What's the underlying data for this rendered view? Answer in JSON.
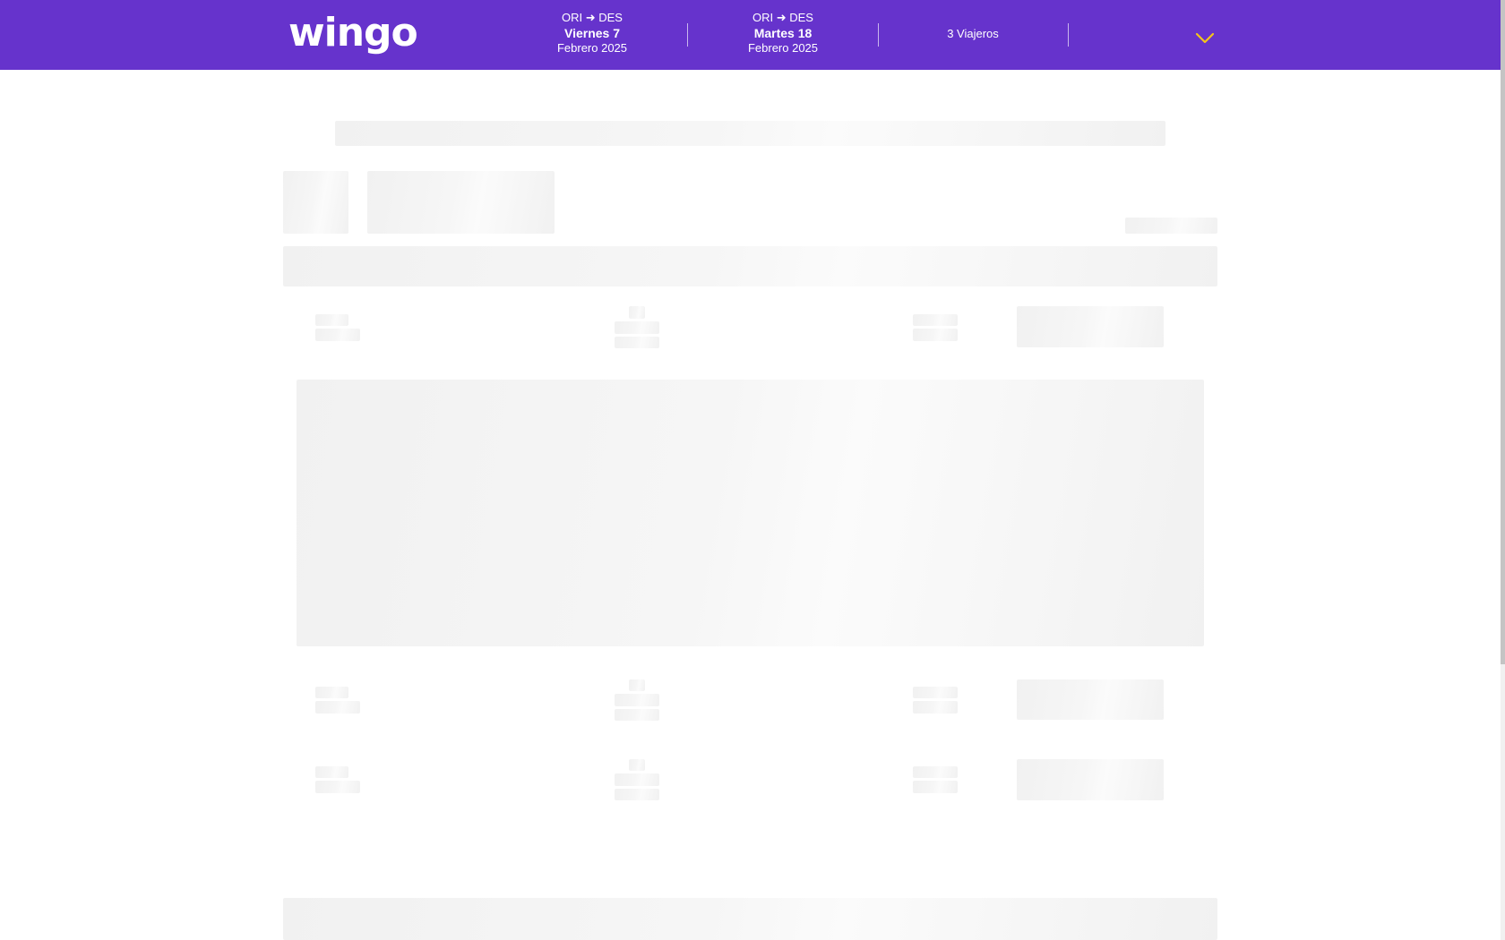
{
  "header": {
    "logo_text": "wingo",
    "outbound": {
      "route": "ORI ➜ DES",
      "day": "Viernes 7",
      "month": "Febrero 2025"
    },
    "return": {
      "route": "ORI ➜ DES",
      "day": "Martes 18",
      "month": "Febrero 2025"
    },
    "travellers": "3 Viajeros",
    "expand_icon": "chevron-down-icon"
  },
  "colors": {
    "brand": "#6633cc",
    "accent": "#f5c518",
    "skeleton": "#f2f2f2"
  },
  "state": "loading-skeleton"
}
